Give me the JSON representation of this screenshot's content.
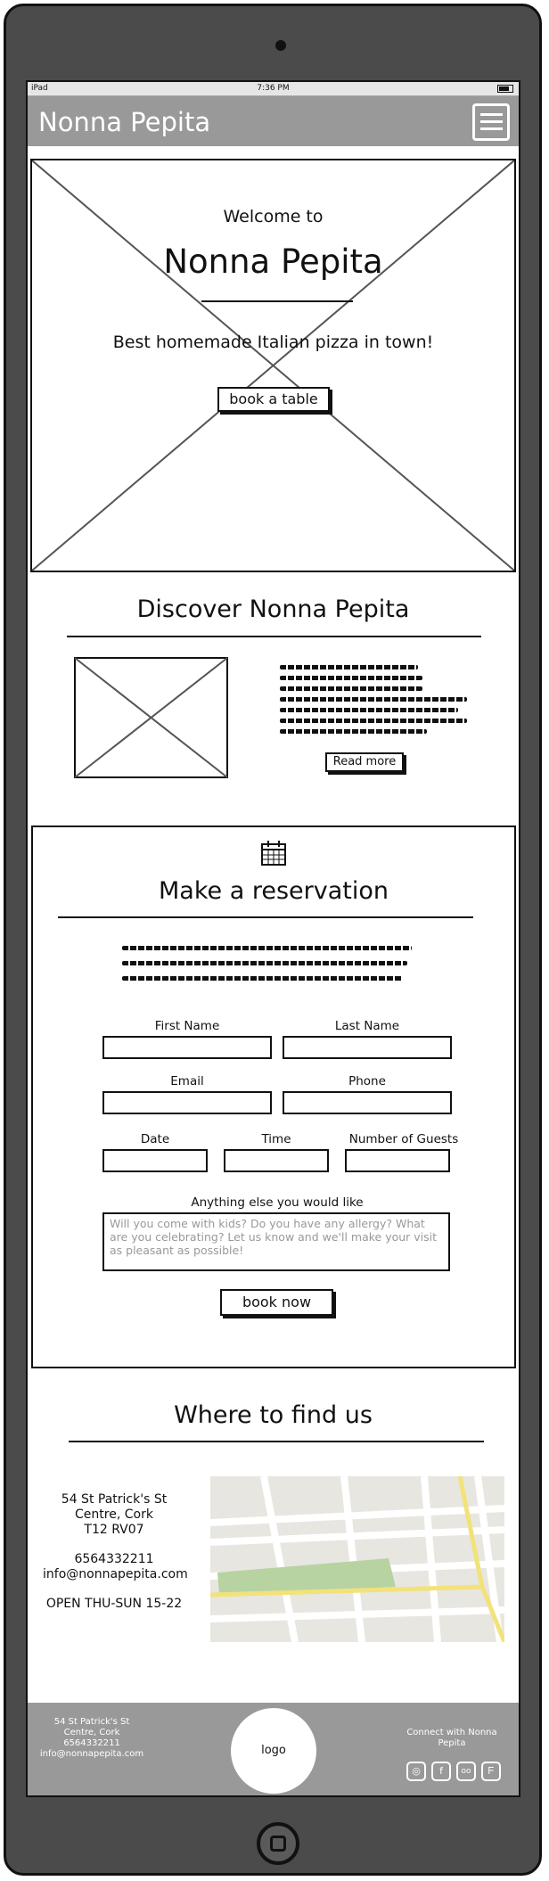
{
  "status_bar": {
    "carrier": "iPad",
    "time": "7:36 PM"
  },
  "navbar": {
    "brand": "Nonna Pepita"
  },
  "hero": {
    "welcome": "Welcome to",
    "title": "Nonna Pepita",
    "tagline": "Best homemade Italian pizza in town!",
    "cta": "book a table"
  },
  "discover": {
    "title": "Discover Nonna Pepita",
    "read_more": "Read more"
  },
  "reservation": {
    "title": "Make a reservation",
    "first_name": "First Name",
    "last_name": "Last Name",
    "email": "Email",
    "phone": "Phone",
    "date": "Date",
    "time": "Time",
    "guests": "Number of Guests",
    "anything_label": "Anything else you would like",
    "anything_placeholder": "Will you come with kids? Do you have any allergy? What are you celebrating? Let us know and we'll make your visit as pleasant as possible!",
    "submit": "book now"
  },
  "find_us": {
    "title": "Where to find us",
    "address_lines": [
      "54 St Patrick's St",
      "Centre, Cork",
      "T12 RV07"
    ],
    "phone": "6564332211",
    "email": "info@nonnapepita.com",
    "hours": "OPEN THU-SUN 15-22"
  },
  "footer": {
    "address_lines": [
      "54 St Patrick's St",
      "Centre, Cork",
      "6564332211",
      "info@nonnapepita.com"
    ],
    "logo": "logo",
    "connect": "Connect with Nonna Pepita",
    "social_icons": [
      "instagram-icon",
      "facebook-icon",
      "tripadvisor-icon",
      "foursquare-icon"
    ]
  }
}
